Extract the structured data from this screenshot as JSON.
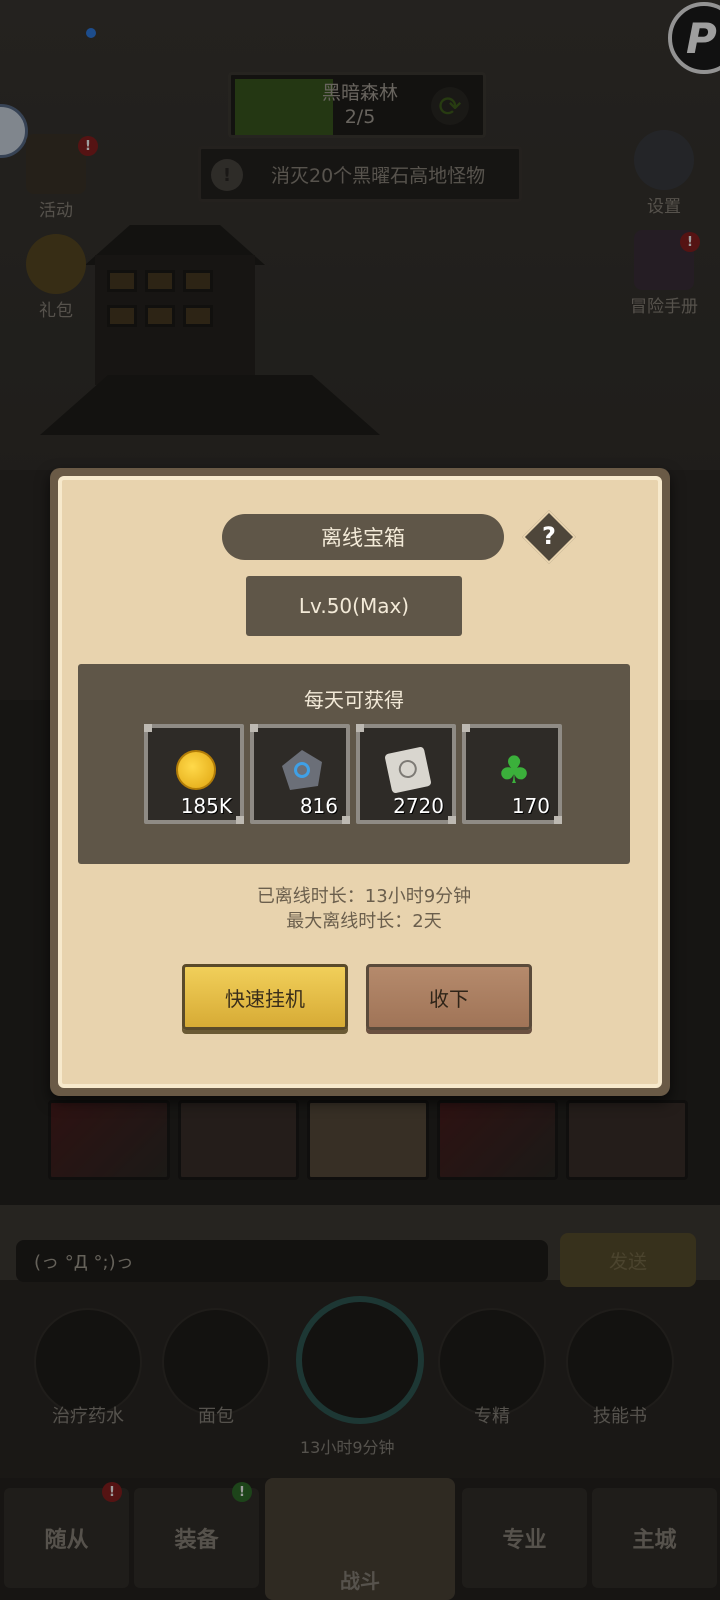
{
  "hud": {
    "stage_name": "黑暗森林",
    "stage_progress": "2/5",
    "stage_progress_fraction": 0.4,
    "quest_text": "消灭20个黑曜石高地怪物",
    "left_icons": [
      {
        "label": "活动",
        "icon": "event-scroll-icon",
        "badge": "!"
      },
      {
        "label": "礼包",
        "icon": "gift-pack-icon"
      }
    ],
    "right_icons": [
      {
        "label": "设置",
        "icon": "gear-icon"
      },
      {
        "label": "冒险手册",
        "icon": "adventure-book-icon",
        "badge": "!"
      }
    ]
  },
  "modal": {
    "title": "离线宝箱",
    "help": "?",
    "level": "Lv.50(Max)",
    "rewards_heading": "每天可获得",
    "rewards": [
      {
        "icon": "gold-coin-icon",
        "amount": "185K"
      },
      {
        "icon": "rune-stone-icon",
        "amount": "816"
      },
      {
        "icon": "scroll-icon",
        "amount": "2720"
      },
      {
        "icon": "clover-icon",
        "amount": "170"
      }
    ],
    "offline_duration": "已离线时长：13小时9分钟",
    "max_offline": "最大离线时长：2天",
    "quick_idle_button": "快速挂机",
    "collect_button": "收下"
  },
  "chat": {
    "input_value": "(っ °Д °;)っ",
    "send_button": "发送"
  },
  "quick_slots": [
    {
      "label": "治疗药水",
      "icon": "healing-potion-icon"
    },
    {
      "label": "面包",
      "icon": "bread-icon"
    },
    {
      "label": "13小时9分钟",
      "icon": "treasure-chest-icon"
    },
    {
      "label": "专精",
      "icon": "specialty-target-icon"
    },
    {
      "label": "技能书",
      "icon": "skill-book-icon"
    }
  ],
  "bottom_nav": [
    {
      "label": "随从",
      "badge": "!"
    },
    {
      "label": "装备",
      "badge": "!"
    },
    {
      "label": "战斗"
    },
    {
      "label": "专业"
    },
    {
      "label": "主城"
    }
  ],
  "colors": {
    "modal_bg": "#e8d3ae",
    "panel_dark": "#5f5648",
    "button_yellow": "#f1cf5a",
    "button_brown": "#b58a6c",
    "stage_progress": "#3a5a1f"
  }
}
